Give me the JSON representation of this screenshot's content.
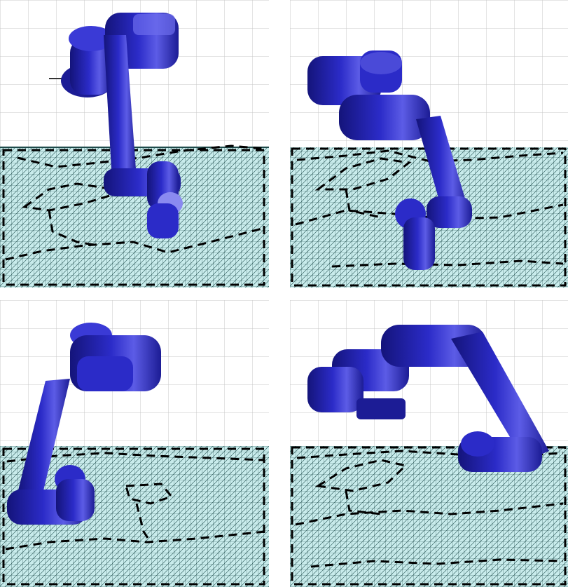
{
  "figure": {
    "panels": [
      {
        "id": "pose-1"
      },
      {
        "id": "pose-2"
      },
      {
        "id": "pose-3"
      },
      {
        "id": "pose-4"
      }
    ]
  },
  "colors": {
    "robot": "#2b2bc8",
    "robot_shadow": "#14147a",
    "robot_highlight": "#8a8af0",
    "terrain_bg": "#c9ecec",
    "terrain_mesh": "#1e4b4b",
    "grid": "#c8c8c8",
    "boundary": "#000000"
  }
}
